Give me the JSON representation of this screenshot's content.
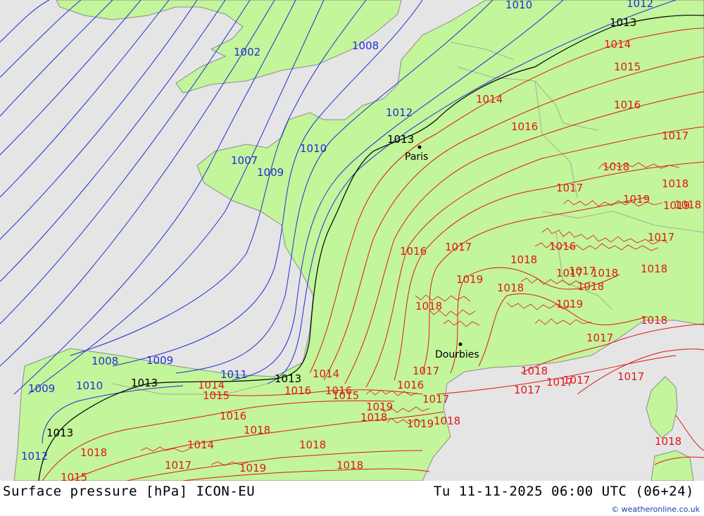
{
  "footer": {
    "title_left": "Surface pressure [hPa] ICON-EU",
    "title_right": "Tu 11-11-2025 06:00 UTC (06+24)",
    "credit": "© weatheronline.co.uk"
  },
  "colors": {
    "sea": "#e5e5e5",
    "land": "#c3f59b",
    "coast": "#8c8c8c",
    "isobar_low": "#1e2fd8",
    "isobar_1013": "#000000",
    "isobar_high": "#e01818"
  },
  "cities": [
    {
      "name": "Paris"
    },
    {
      "name": "Dourbies"
    }
  ],
  "isobar_labels": [
    {
      "text": "1010",
      "kind": "low"
    },
    {
      "text": "1012",
      "kind": "low"
    },
    {
      "text": "1013",
      "kind": "ref"
    },
    {
      "text": "1014",
      "kind": "high"
    },
    {
      "text": "1015",
      "kind": "high"
    },
    {
      "text": "1016",
      "kind": "high"
    },
    {
      "text": "1017",
      "kind": "high"
    },
    {
      "text": "1018",
      "kind": "high"
    },
    {
      "text": "1019",
      "kind": "high"
    },
    {
      "text": "1002",
      "kind": "low"
    },
    {
      "text": "1008",
      "kind": "low"
    },
    {
      "text": "1012",
      "kind": "low"
    },
    {
      "text": "1014",
      "kind": "high"
    },
    {
      "text": "1016",
      "kind": "high"
    },
    {
      "text": "1017",
      "kind": "high"
    },
    {
      "text": "1013",
      "kind": "ref"
    },
    {
      "text": "1010",
      "kind": "low"
    },
    {
      "text": "1007",
      "kind": "low"
    },
    {
      "text": "1009",
      "kind": "low"
    },
    {
      "text": "1016",
      "kind": "high"
    },
    {
      "text": "1017",
      "kind": "high"
    },
    {
      "text": "1018",
      "kind": "high"
    },
    {
      "text": "1019",
      "kind": "high"
    },
    {
      "text": "1018",
      "kind": "high"
    },
    {
      "text": "1017",
      "kind": "high"
    },
    {
      "text": "1016",
      "kind": "high"
    },
    {
      "text": "1018",
      "kind": "high"
    },
    {
      "text": "1019",
      "kind": "high"
    },
    {
      "text": "1018",
      "kind": "high"
    },
    {
      "text": "1017",
      "kind": "high"
    },
    {
      "text": "1018",
      "kind": "high"
    },
    {
      "text": "1019",
      "kind": "high"
    },
    {
      "text": "1018",
      "kind": "high"
    },
    {
      "text": "1018",
      "kind": "high"
    },
    {
      "text": "1017",
      "kind": "high"
    },
    {
      "text": "1018",
      "kind": "high"
    },
    {
      "text": "1018",
      "kind": "high"
    },
    {
      "text": "1017",
      "kind": "high"
    },
    {
      "text": "1017",
      "kind": "high"
    },
    {
      "text": "1017",
      "kind": "high"
    },
    {
      "text": "1018",
      "kind": "high"
    },
    {
      "text": "1008",
      "kind": "low"
    },
    {
      "text": "1009",
      "kind": "low"
    },
    {
      "text": "1009",
      "kind": "low"
    },
    {
      "text": "1010",
      "kind": "low"
    },
    {
      "text": "1013",
      "kind": "ref"
    },
    {
      "text": "1011",
      "kind": "low"
    },
    {
      "text": "1013",
      "kind": "ref"
    },
    {
      "text": "1012",
      "kind": "low"
    },
    {
      "text": "1013",
      "kind": "ref"
    },
    {
      "text": "1014",
      "kind": "high"
    },
    {
      "text": "1015",
      "kind": "high"
    },
    {
      "text": "1016",
      "kind": "high"
    },
    {
      "text": "1014",
      "kind": "high"
    },
    {
      "text": "1016",
      "kind": "high"
    },
    {
      "text": "1017",
      "kind": "high"
    },
    {
      "text": "1016",
      "kind": "high"
    },
    {
      "text": "1017",
      "kind": "high"
    },
    {
      "text": "1015",
      "kind": "high"
    },
    {
      "text": "1019",
      "kind": "high"
    },
    {
      "text": "1018",
      "kind": "high"
    },
    {
      "text": "1019",
      "kind": "high"
    },
    {
      "text": "1018",
      "kind": "high"
    },
    {
      "text": "1016",
      "kind": "high"
    },
    {
      "text": "1018",
      "kind": "high"
    },
    {
      "text": "1018",
      "kind": "high"
    },
    {
      "text": "1014",
      "kind": "high"
    },
    {
      "text": "1018",
      "kind": "high"
    },
    {
      "text": "1017",
      "kind": "high"
    },
    {
      "text": "1019",
      "kind": "high"
    },
    {
      "text": "1018",
      "kind": "high"
    },
    {
      "text": "1015",
      "kind": "high"
    },
    {
      "text": "1018",
      "kind": "high"
    },
    {
      "text": "1017",
      "kind": "high"
    },
    {
      "text": "1017",
      "kind": "high"
    }
  ]
}
